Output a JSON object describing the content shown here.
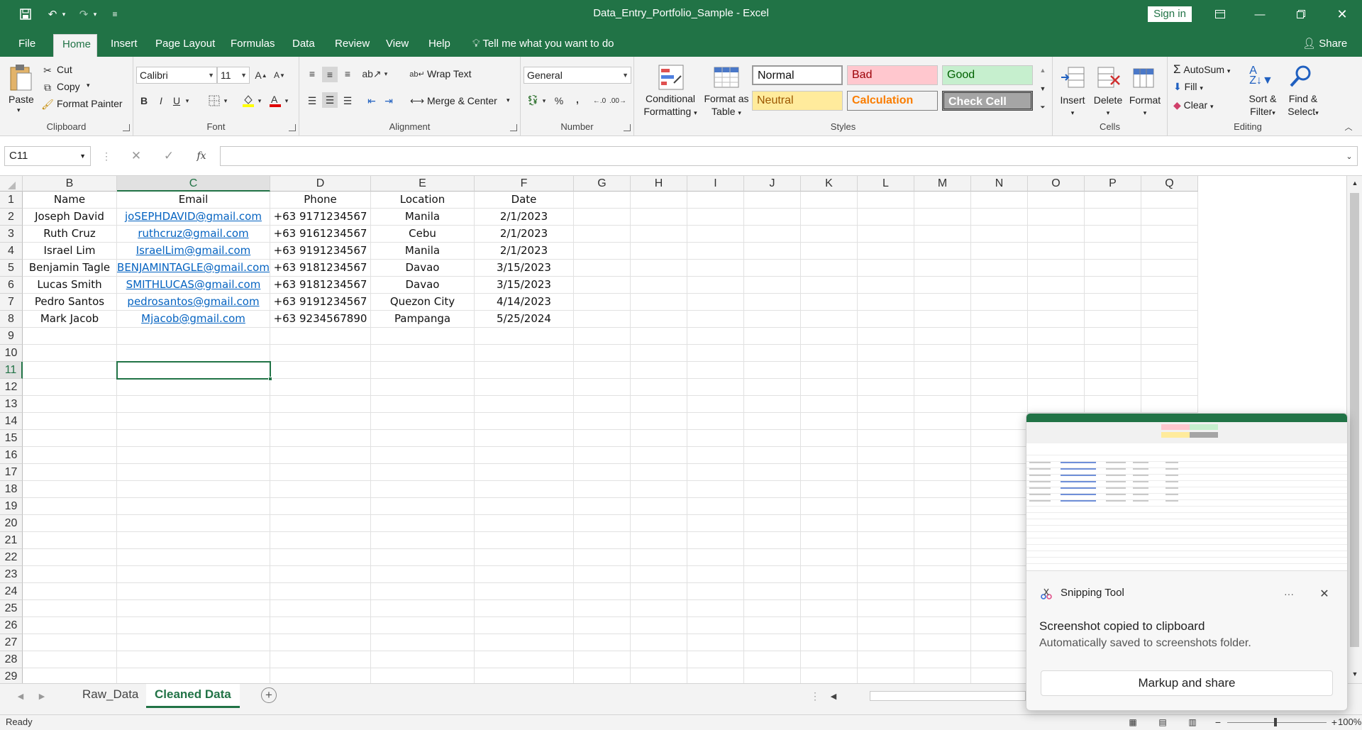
{
  "window": {
    "title": "Data_Entry_Portfolio_Sample  -  Excel",
    "sign_in": "Sign in"
  },
  "menu_tabs": [
    "File",
    "Home",
    "Insert",
    "Page Layout",
    "Formulas",
    "Data",
    "Review",
    "View",
    "Help"
  ],
  "tell_me": "Tell me what you want to do",
  "share": "Share",
  "ribbon": {
    "clipboard": {
      "paste": "Paste",
      "cut": "Cut",
      "copy": "Copy",
      "format_painter": "Format Painter",
      "label": "Clipboard"
    },
    "font": {
      "name": "Calibri",
      "size": "11",
      "label": "Font",
      "bold": "B",
      "italic": "I",
      "underline": "U"
    },
    "alignment": {
      "wrap_text": "Wrap Text",
      "merge_center": "Merge & Center",
      "label": "Alignment"
    },
    "number": {
      "format": "General",
      "label": "Number",
      "percent": "%",
      "comma": ","
    },
    "styles": {
      "conditional": [
        "Conditional",
        "Formatting"
      ],
      "format_table": [
        "Format as",
        "Table"
      ],
      "normal": "Normal",
      "bad": "Bad",
      "good": "Good",
      "neutral": "Neutral",
      "calculation": "Calculation",
      "check_cell": "Check Cell",
      "label": "Styles"
    },
    "cells": {
      "insert": "Insert",
      "delete": "Delete",
      "format": "Format",
      "label": "Cells"
    },
    "editing": {
      "autosum": "AutoSum",
      "fill": "Fill",
      "clear": "Clear",
      "sort_filter": [
        "Sort &",
        "Filter"
      ],
      "find_select": [
        "Find &",
        "Select"
      ],
      "label": "Editing"
    }
  },
  "name_box": "C11",
  "fx": "fx",
  "sheet": {
    "columns": [
      "B",
      "C",
      "D",
      "E",
      "F",
      "G",
      "H",
      "I",
      "J",
      "K",
      "L",
      "M",
      "N",
      "O",
      "P",
      "Q"
    ],
    "row_numbers": [
      "1",
      "2",
      "3",
      "4",
      "5",
      "6",
      "7",
      "8",
      "9",
      "10",
      "11",
      "12",
      "13",
      "14",
      "15",
      "16",
      "17",
      "18",
      "19",
      "20",
      "21",
      "22",
      "23",
      "24",
      "25",
      "26",
      "27",
      "28",
      "29"
    ],
    "headers": [
      "Name",
      "Email",
      "Phone",
      "Location",
      "Date"
    ],
    "rows": [
      [
        "Joseph David",
        "joSEPHDAVID@gmail.com",
        "+63 9171234567",
        "Manila",
        "2/1/2023"
      ],
      [
        "Ruth Cruz",
        "ruthcruz@gmail.com",
        "+63 9161234567",
        "Cebu",
        "2/1/2023"
      ],
      [
        "Israel Lim",
        "IsraelLim@gmail.com",
        "+63 9191234567",
        "Manila",
        "2/1/2023"
      ],
      [
        "Benjamin Tagle",
        "BENJAMINTAGLE@gmail.com",
        "+63 9181234567",
        "Davao",
        "3/15/2023"
      ],
      [
        "Lucas Smith",
        "SMITHLUCAS@gmail.com",
        "+63 9181234567",
        "Davao",
        "3/15/2023"
      ],
      [
        "Pedro Santos",
        "pedrosantos@gmail.com",
        "+63 9191234567",
        "Quezon City",
        "4/14/2023"
      ],
      [
        "Mark Jacob",
        "Mjacob@gmail.com",
        "+63 9234567890",
        "Pampanga",
        "5/25/2024"
      ]
    ]
  },
  "sheet_tabs": [
    "Raw_Data",
    "Cleaned Data"
  ],
  "status": {
    "ready": "Ready",
    "zoom": "100%"
  },
  "toast": {
    "app": "Snipping Tool",
    "message": "Screenshot copied to clipboard",
    "sub": "Automatically saved to screenshots folder.",
    "button": "Markup and share",
    "more": "···"
  },
  "colors": {
    "excel_green": "#217346",
    "link": "#0563c1"
  }
}
